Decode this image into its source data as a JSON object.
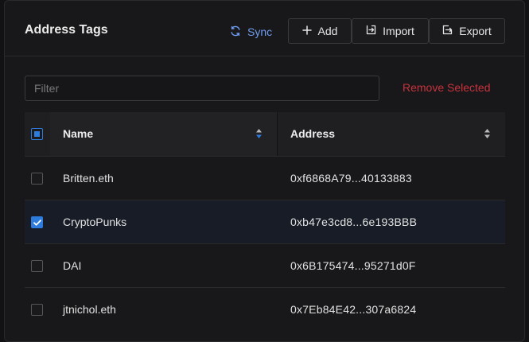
{
  "header": {
    "title": "Address Tags",
    "sync_label": "Sync",
    "add_label": "Add",
    "import_label": "Import",
    "export_label": "Export"
  },
  "filter": {
    "placeholder": "Filter",
    "value": ""
  },
  "remove_selected_label": "Remove Selected",
  "table": {
    "columns": [
      "Name",
      "Address"
    ],
    "header_checkbox_state": "indeterminate",
    "rows": [
      {
        "name": "Britten.eth",
        "address": "0xf6868A79...40133883",
        "checked": false
      },
      {
        "name": "CryptoPunks",
        "address": "0xb47e3cd8...6e193BBB",
        "checked": true
      },
      {
        "name": "DAI",
        "address": "0x6B175474...95271d0F",
        "checked": false
      },
      {
        "name": "jtnichol.eth",
        "address": "0x7Eb84E42...307a6824",
        "checked": false
      }
    ]
  },
  "icons": {
    "sync": "sync-icon",
    "add": "plus-icon",
    "import": "import-icon",
    "export": "export-icon",
    "sort": "sort-icon",
    "check": "check-icon"
  },
  "colors": {
    "accent": "#2d7bdc",
    "link": "#6f9cf0",
    "danger": "#c9323c",
    "background": "#18181a"
  }
}
